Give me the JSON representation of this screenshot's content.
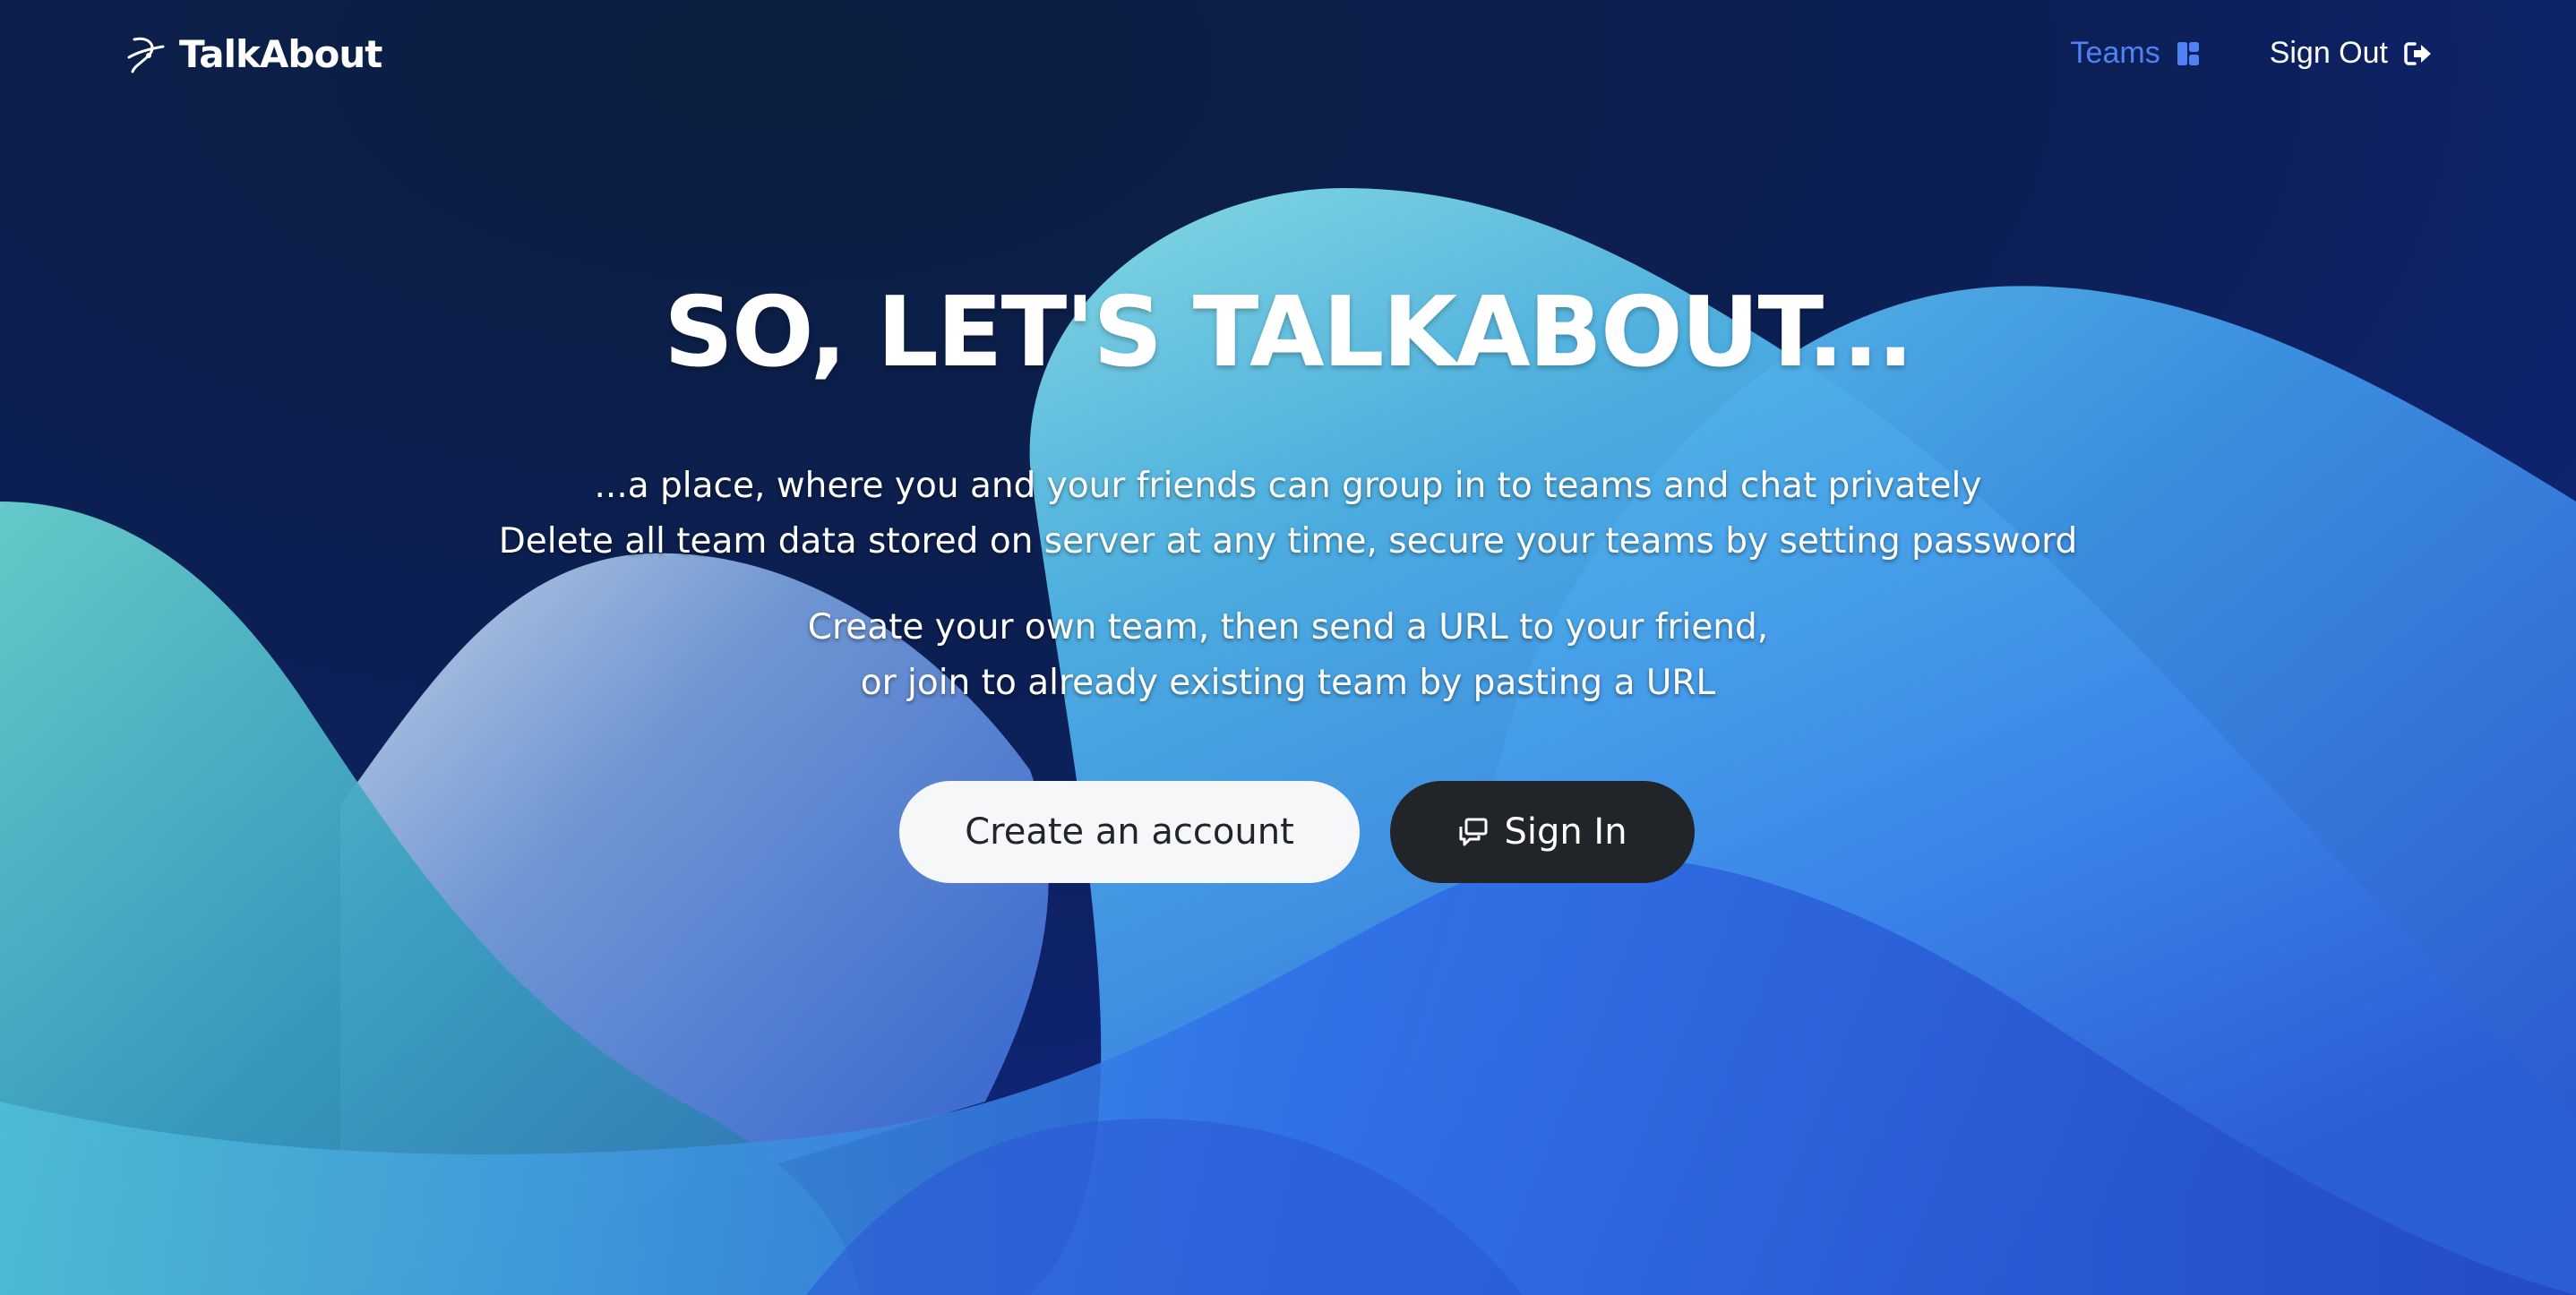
{
  "brand": {
    "name": "TalkAbout",
    "icon": "orbit-logo-icon"
  },
  "nav": {
    "teams_label": "Teams",
    "teams_icon": "layout-grid-icon",
    "signout_label": "Sign Out",
    "signout_icon": "door-exit-icon"
  },
  "hero": {
    "title": "SO, LET'S TALKABOUT...",
    "line1": "...a place, where you and your friends can group in to teams and chat privately",
    "line2": "Delete all team data stored on server at any time, secure your teams by setting password",
    "line3": "Create your own team, then send a URL to your friend,",
    "line4": "or join to already existing team by pasting a URL"
  },
  "buttons": {
    "create_account": "Create an account",
    "sign_in": "Sign In",
    "sign_in_icon": "chat-squares-icon"
  },
  "colors": {
    "background_dark": "#0c1a3f",
    "accent_blue": "#4f82f5",
    "button_light": "#f6f7f9",
    "button_dark": "#212529"
  }
}
